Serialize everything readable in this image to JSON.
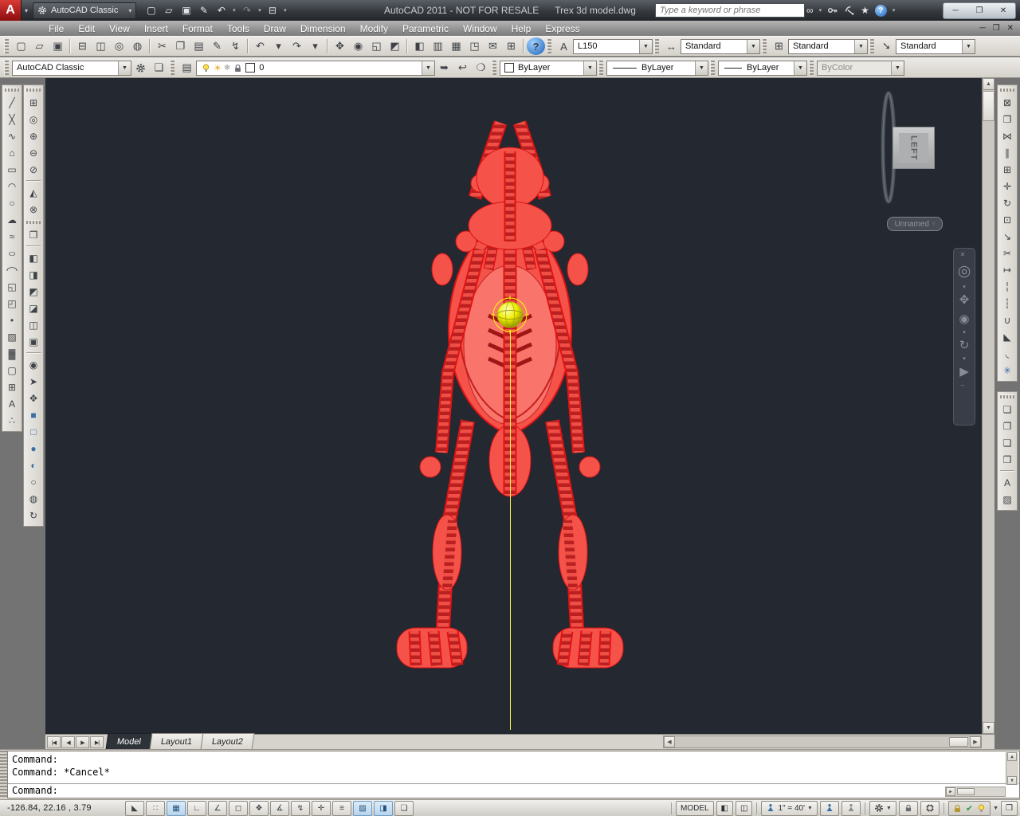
{
  "window": {
    "app_initial": "A",
    "workspace": "AutoCAD Classic",
    "title": "AutoCAD 2011 - NOT FOR RESALE",
    "document": "Trex 3d model.dwg",
    "search_placeholder": "Type a keyword or phrase"
  },
  "menu": {
    "items": [
      {
        "name": "menu-file",
        "label": "File"
      },
      {
        "name": "menu-edit",
        "label": "Edit"
      },
      {
        "name": "menu-view",
        "label": "View"
      },
      {
        "name": "menu-insert",
        "label": "Insert"
      },
      {
        "name": "menu-format",
        "label": "Format"
      },
      {
        "name": "menu-tools",
        "label": "Tools"
      },
      {
        "name": "menu-draw",
        "label": "Draw"
      },
      {
        "name": "menu-dimension",
        "label": "Dimension"
      },
      {
        "name": "menu-modify",
        "label": "Modify"
      },
      {
        "name": "menu-parametric",
        "label": "Parametric"
      },
      {
        "name": "menu-window",
        "label": "Window"
      },
      {
        "name": "menu-help",
        "label": "Help"
      },
      {
        "name": "menu-express",
        "label": "Express"
      }
    ]
  },
  "quick_access": {
    "items": [
      {
        "name": "qnew",
        "glyph": "▢"
      },
      {
        "name": "open",
        "glyph": "▱"
      },
      {
        "name": "save",
        "glyph": "▣"
      },
      {
        "name": "save-as",
        "glyph": "✎"
      },
      {
        "name": "undo",
        "glyph": "↶"
      },
      {
        "name": "undo-dropdown",
        "glyph": "▾",
        "cls": "narrow"
      },
      {
        "name": "redo",
        "glyph": "↷",
        "cls": "dim"
      },
      {
        "name": "redo-dropdown",
        "glyph": "▾",
        "cls": "narrow"
      },
      {
        "name": "plot",
        "glyph": "⊟"
      },
      {
        "name": "plot-dropdown",
        "glyph": "▾",
        "cls": "narrow"
      }
    ]
  },
  "window_controls": {
    "items": [
      {
        "name": "minimize-button",
        "glyph": "─"
      },
      {
        "name": "restore-button",
        "glyph": "❐"
      },
      {
        "name": "close-button",
        "glyph": "✕"
      }
    ]
  },
  "doc_controls": {
    "items": [
      {
        "name": "doc-minimize-button",
        "glyph": "─"
      },
      {
        "name": "doc-restore-button",
        "glyph": "❐"
      },
      {
        "name": "doc-close-button",
        "glyph": "✕"
      }
    ]
  },
  "standard_toolbar": {
    "items": [
      {
        "name": "new",
        "glyph": "▢"
      },
      {
        "name": "open",
        "glyph": "▱"
      },
      {
        "name": "save",
        "glyph": "▣"
      },
      {
        "sep": true
      },
      {
        "name": "plot",
        "glyph": "⊟"
      },
      {
        "name": "plot-preview",
        "glyph": "◫"
      },
      {
        "name": "publish",
        "glyph": "◎"
      },
      {
        "name": "3d-dwf",
        "glyph": "◍"
      },
      {
        "sep": true
      },
      {
        "name": "cut",
        "glyph": "✂"
      },
      {
        "name": "copy",
        "glyph": "❐"
      },
      {
        "name": "paste",
        "glyph": "▤"
      },
      {
        "name": "match-properties",
        "glyph": "✎"
      },
      {
        "name": "block-editor",
        "glyph": "↯"
      },
      {
        "sep": true
      },
      {
        "name": "undo",
        "glyph": "↶"
      },
      {
        "name": "undo-dropdown",
        "glyph": "▾",
        "cls": "narrow"
      },
      {
        "name": "redo",
        "glyph": "↷"
      },
      {
        "name": "redo-dropdown",
        "glyph": "▾",
        "cls": "narrow"
      },
      {
        "sep": true
      },
      {
        "name": "pan-realtime",
        "glyph": "✥"
      },
      {
        "name": "zoom-realtime",
        "glyph": "◉"
      },
      {
        "name": "zoom-window",
        "glyph": "◱"
      },
      {
        "name": "zoom-previous",
        "glyph": "◩"
      },
      {
        "sep": true
      },
      {
        "name": "properties",
        "glyph": "◧"
      },
      {
        "name": "designcenter",
        "glyph": "▥"
      },
      {
        "name": "tool-palettes",
        "glyph": "▦"
      },
      {
        "name": "sheet-set-manager",
        "glyph": "◳"
      },
      {
        "name": "markup-set-manager",
        "glyph": "✉"
      },
      {
        "name": "quickcalc",
        "glyph": "⊞"
      },
      {
        "sep": true
      },
      {
        "name": "help",
        "glyph": "?",
        "cls": "helpic"
      }
    ]
  },
  "styles_toolbar": {
    "text_style": "L150",
    "dim_style": "Standard",
    "table_style": "Standard",
    "mleader_style": "Standard"
  },
  "layers_toolbar": {
    "current_layer": "0"
  },
  "layer_tools": {
    "items": [
      {
        "name": "make-object-layer-current",
        "glyph": "➥"
      },
      {
        "name": "layer-previous",
        "glyph": "↩"
      },
      {
        "name": "layer-states",
        "glyph": "❍"
      }
    ]
  },
  "properties_toolbar": {
    "color": "ByLayer",
    "linetype": "ByLayer",
    "lineweight": "ByLayer",
    "plot_style": "ByColor"
  },
  "draw_toolbar": {
    "items": [
      {
        "name": "line",
        "glyph": "╱"
      },
      {
        "name": "construction-line",
        "glyph": "╳"
      },
      {
        "name": "polyline",
        "glyph": "∿"
      },
      {
        "name": "polygon",
        "glyph": "⌂"
      },
      {
        "name": "rectangle",
        "glyph": "▭"
      },
      {
        "name": "arc",
        "glyph": "◠"
      },
      {
        "name": "circle",
        "glyph": "○"
      },
      {
        "name": "revision-cloud",
        "glyph": "☁"
      },
      {
        "name": "spline",
        "glyph": "≈"
      },
      {
        "name": "ellipse",
        "glyph": "○",
        "cls": "wide"
      },
      {
        "name": "ellipse-arc",
        "glyph": "◠",
        "cls": "wide"
      },
      {
        "name": "insert-block",
        "glyph": "◱"
      },
      {
        "name": "make-block",
        "glyph": "◰"
      },
      {
        "name": "point",
        "glyph": "•"
      },
      {
        "name": "hatch",
        "glyph": "▨"
      },
      {
        "name": "gradient",
        "glyph": "▓"
      },
      {
        "name": "region",
        "glyph": "▢"
      },
      {
        "name": "table",
        "glyph": "⊞"
      },
      {
        "name": "multiline-text",
        "glyph": "A"
      },
      {
        "name": "divide",
        "glyph": "∴"
      }
    ]
  },
  "view_toolbar": {
    "items": [
      {
        "name": "viewports",
        "glyph": "⊞"
      },
      {
        "name": "named-views",
        "glyph": "◎"
      },
      {
        "name": "new-view",
        "glyph": "⊕"
      },
      {
        "name": "remove-view",
        "glyph": "⊖"
      },
      {
        "name": "no-view",
        "glyph": "⊘"
      },
      {
        "sep": true
      },
      {
        "name": "rotate-view",
        "glyph": "◭"
      },
      {
        "name": "delete-view",
        "glyph": "⊗"
      }
    ]
  },
  "visual_styles_toolbar": {
    "items": [
      {
        "name": "layout-paste",
        "glyph": "❐"
      },
      {
        "sep": true
      },
      {
        "name": "vs-2d-wireframe",
        "glyph": "◧"
      },
      {
        "name": "vs-3d-wireframe",
        "glyph": "◨"
      },
      {
        "name": "vs-3d-hidden",
        "glyph": "◩"
      },
      {
        "name": "vs-realistic",
        "glyph": "◪"
      },
      {
        "name": "vs-conceptual",
        "glyph": "◫"
      },
      {
        "name": "vs-shades-of-gray",
        "glyph": "▣"
      },
      {
        "sep": true
      },
      {
        "name": "camera",
        "glyph": "◉"
      },
      {
        "name": "motion-path",
        "glyph": "➤"
      },
      {
        "name": "walk-fly",
        "glyph": "✥"
      },
      {
        "name": "solid-box",
        "glyph": "■",
        "cls": "blue"
      },
      {
        "name": "wire-box",
        "glyph": "□",
        "cls": "blue"
      },
      {
        "name": "solid-sphere",
        "glyph": "●",
        "cls": "blue"
      },
      {
        "name": "shaded-sphere",
        "glyph": "◐",
        "cls": "blue"
      },
      {
        "name": "wire-sphere",
        "glyph": "○"
      },
      {
        "name": "geographic-location",
        "glyph": "◍"
      },
      {
        "name": "free-orbit",
        "glyph": "↻"
      }
    ]
  },
  "modify_toolbar": {
    "items": [
      {
        "name": "erase",
        "glyph": "⊠"
      },
      {
        "name": "copy-object",
        "glyph": "❐"
      },
      {
        "name": "mirror",
        "glyph": "⋈"
      },
      {
        "name": "offset",
        "glyph": "∥"
      },
      {
        "name": "array",
        "glyph": "⊞"
      },
      {
        "name": "move",
        "glyph": "✛"
      },
      {
        "name": "rotate",
        "glyph": "↻"
      },
      {
        "name": "scale",
        "glyph": "⊡"
      },
      {
        "name": "stretch",
        "glyph": "↘"
      },
      {
        "name": "trim",
        "glyph": "✂"
      },
      {
        "name": "extend",
        "glyph": "↦"
      },
      {
        "name": "break-at-point",
        "glyph": "╎"
      },
      {
        "name": "break",
        "glyph": "┆"
      },
      {
        "name": "join",
        "glyph": "∪"
      },
      {
        "name": "chamfer",
        "glyph": "◣"
      },
      {
        "name": "fillet",
        "glyph": "◟"
      },
      {
        "name": "explode",
        "glyph": "✳",
        "cls": "blue"
      }
    ]
  },
  "draworder_toolbar": {
    "items": [
      {
        "name": "bring-to-front",
        "glyph": "❏"
      },
      {
        "name": "send-to-back",
        "glyph": "❐"
      },
      {
        "name": "bring-above-objects",
        "glyph": "❑"
      },
      {
        "name": "send-under-objects",
        "glyph": "❒"
      },
      {
        "sep": true
      },
      {
        "name": "text-to-front",
        "glyph": "A"
      },
      {
        "name": "hatch-to-back",
        "glyph": "▨"
      }
    ]
  },
  "navbar": {
    "items": [
      {
        "name": "navbar-close",
        "glyph": "✕",
        "cls": "nb-x"
      },
      {
        "name": "full-navigation-wheel",
        "glyph": "◎",
        "cls": "nb-big"
      },
      {
        "name": "wheel-dropdown",
        "glyph": "▾",
        "cls": "nb-dd"
      },
      {
        "name": "nav-pan",
        "glyph": "✥"
      },
      {
        "name": "nav-zoom-extents",
        "glyph": "◉"
      },
      {
        "name": "zoom-dropdown",
        "glyph": "▾",
        "cls": "nb-dd"
      },
      {
        "name": "nav-orbit",
        "glyph": "↻"
      },
      {
        "name": "orbit-dropdown",
        "glyph": "▾",
        "cls": "nb-dd"
      },
      {
        "name": "show-motion",
        "glyph": "▶"
      },
      {
        "name": "navbar-minimize",
        "glyph": "−",
        "cls": "nb-x"
      }
    ]
  },
  "viewport": {
    "viewcube_face": "LEFT",
    "view_pill": "Unnamed"
  },
  "layout_tabs": {
    "nav": [
      {
        "name": "tab-first",
        "glyph": "|◀"
      },
      {
        "name": "tab-prev",
        "glyph": "◀"
      },
      {
        "name": "tab-next",
        "glyph": "▶"
      },
      {
        "name": "tab-last",
        "glyph": "▶|"
      }
    ],
    "tabs": [
      {
        "name": "tab-model",
        "label": "Model",
        "active": true
      },
      {
        "name": "tab-layout1",
        "label": "Layout1"
      },
      {
        "name": "tab-layout2",
        "label": "Layout2"
      }
    ]
  },
  "command_line": {
    "history_line1": "Command:",
    "history_line2": "Command: *Cancel*",
    "prompt": "Command:"
  },
  "status_bar": {
    "coords": "-126.84, 22.16 , 3.79",
    "toggles": [
      {
        "name": "infer-constraints",
        "glyph": "◣"
      },
      {
        "name": "snap-mode",
        "glyph": "∷"
      },
      {
        "name": "grid-display",
        "glyph": "▦",
        "active": true
      },
      {
        "name": "ortho-mode",
        "glyph": "∟"
      },
      {
        "name": "polar-tracking",
        "glyph": "∠"
      },
      {
        "name": "object-snap",
        "glyph": "◻"
      },
      {
        "name": "3d-object-snap",
        "glyph": "❖"
      },
      {
        "name": "object-snap-tracking",
        "glyph": "∡"
      },
      {
        "name": "dynamic-ucs",
        "glyph": "↯"
      },
      {
        "name": "dynamic-input",
        "glyph": "✛"
      },
      {
        "name": "show-lineweight",
        "glyph": "≡"
      },
      {
        "name": "show-transparency",
        "glyph": "▨",
        "active": true
      },
      {
        "name": "quick-properties",
        "glyph": "◨",
        "active": true
      },
      {
        "name": "selection-cycling",
        "glyph": "❏"
      }
    ],
    "model_button": "MODEL",
    "annotation_scale": "1\" = 40'"
  },
  "colors": {
    "canvas_bg": "#232831",
    "model_red": "#f5524a",
    "model_red_dark": "#bb2020",
    "model_red_outline": "#e01414",
    "model_red_pale": "#f9756b",
    "selection_yellow": "#ffff00",
    "axis_yellow": "#f7f74c",
    "status_active_blue": "#b7d4ec",
    "titlebar_dark": "#35393e"
  }
}
